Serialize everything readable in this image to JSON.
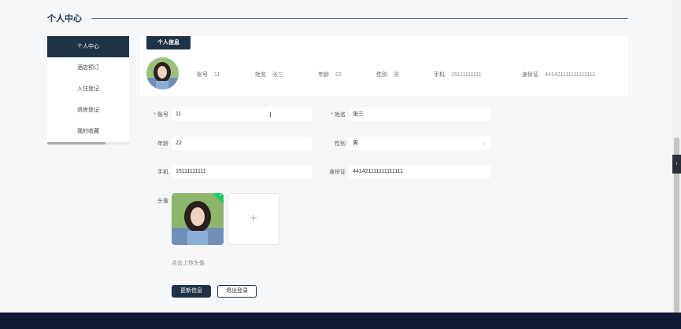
{
  "page_title": "个人中心",
  "sidebar": {
    "items": [
      {
        "label": "个人中心",
        "active": true
      },
      {
        "label": "酒店预订",
        "active": false
      },
      {
        "label": "入住登记",
        "active": false
      },
      {
        "label": "退房登记",
        "active": false
      },
      {
        "label": "我的收藏",
        "active": false
      }
    ]
  },
  "info_card": {
    "tab_label": "个人信息",
    "fields": [
      {
        "label": "账号",
        "value": "11"
      },
      {
        "label": "姓名",
        "value": "张三"
      },
      {
        "label": "年龄",
        "value": "22"
      },
      {
        "label": "性别",
        "value": "男"
      },
      {
        "label": "手机",
        "value": "15111111111"
      },
      {
        "label": "身份证",
        "value": "441421111111111111"
      }
    ]
  },
  "form": {
    "account": {
      "label": "账号",
      "value": "11"
    },
    "name": {
      "label": "姓名",
      "value": "张三"
    },
    "age": {
      "label": "年龄",
      "value": "22"
    },
    "gender": {
      "label": "性别",
      "value": "男"
    },
    "phone": {
      "label": "手机",
      "value": "15111111111"
    },
    "idcard": {
      "label": "身份证",
      "value": "441421111111111111"
    },
    "avatar": {
      "label": "头像",
      "tip": "点击上传头像",
      "add_symbol": "+"
    }
  },
  "buttons": {
    "update": "更新信息",
    "logout": "退出登录"
  },
  "colors": {
    "primary": "#1f3347",
    "footer": "#0e1a33",
    "required": "#e04848",
    "success": "#13ce66"
  }
}
